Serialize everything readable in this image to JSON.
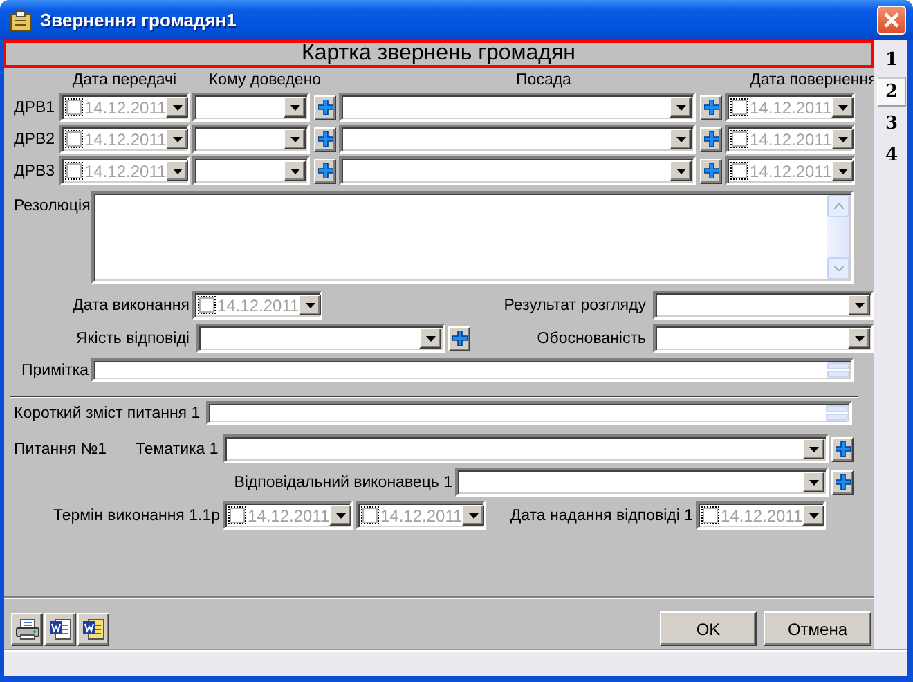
{
  "window": {
    "title": "Звернення громадян1"
  },
  "header": "Картка звернень громадян",
  "tabs": [
    {
      "label": "1",
      "selected": false
    },
    {
      "label": "2",
      "selected": true
    },
    {
      "label": "3",
      "selected": false
    },
    {
      "label": "4",
      "selected": false
    }
  ],
  "drv": {
    "columns": [
      "Дата передачі",
      "Кому доведено",
      "Посада",
      "Дата повернення"
    ],
    "rows": [
      {
        "label": "ДРВ1",
        "date_sent": {
          "value": "14.12.2011",
          "checked": false
        },
        "date_returned": {
          "value": "14.12.2011",
          "checked": false
        }
      },
      {
        "label": "ДРВ2",
        "date_sent": {
          "value": "14.12.2011",
          "checked": false
        },
        "date_returned": {
          "value": "14.12.2011",
          "checked": false
        }
      },
      {
        "label": "ДРВ3",
        "date_sent": {
          "value": "14.12.2011",
          "checked": false
        },
        "date_returned": {
          "value": "14.12.2011",
          "checked": false
        }
      }
    ]
  },
  "resolution": {
    "label": "Резолюція"
  },
  "execution_date": {
    "label": "Дата виконання",
    "value": "14.12.2011",
    "checked": false
  },
  "review_result": {
    "label": "Результат розгляду"
  },
  "answer_quality": {
    "label": "Якість відповіді"
  },
  "validity": {
    "label": "Обоснованість"
  },
  "note": {
    "label": "Примітка"
  },
  "question": {
    "summary_label": "Короткий зміст питання 1",
    "title": "Питання №1",
    "topic_label": "Тематика 1",
    "executor_label": "Відповідальний виконавець 1",
    "term_label": "Термін виконання 1.1р",
    "term_dates": [
      {
        "value": "14.12.2011",
        "checked": false
      },
      {
        "value": "14.12.2011",
        "checked": false
      }
    ],
    "answer_date": {
      "label": "Дата надання відповіді 1",
      "value": "14.12.2011",
      "checked": false
    }
  },
  "toolbar": [
    {
      "kind": "print"
    },
    {
      "kind": "word"
    },
    {
      "kind": "word-report"
    }
  ],
  "buttons": [
    "OK",
    "Отмена"
  ]
}
